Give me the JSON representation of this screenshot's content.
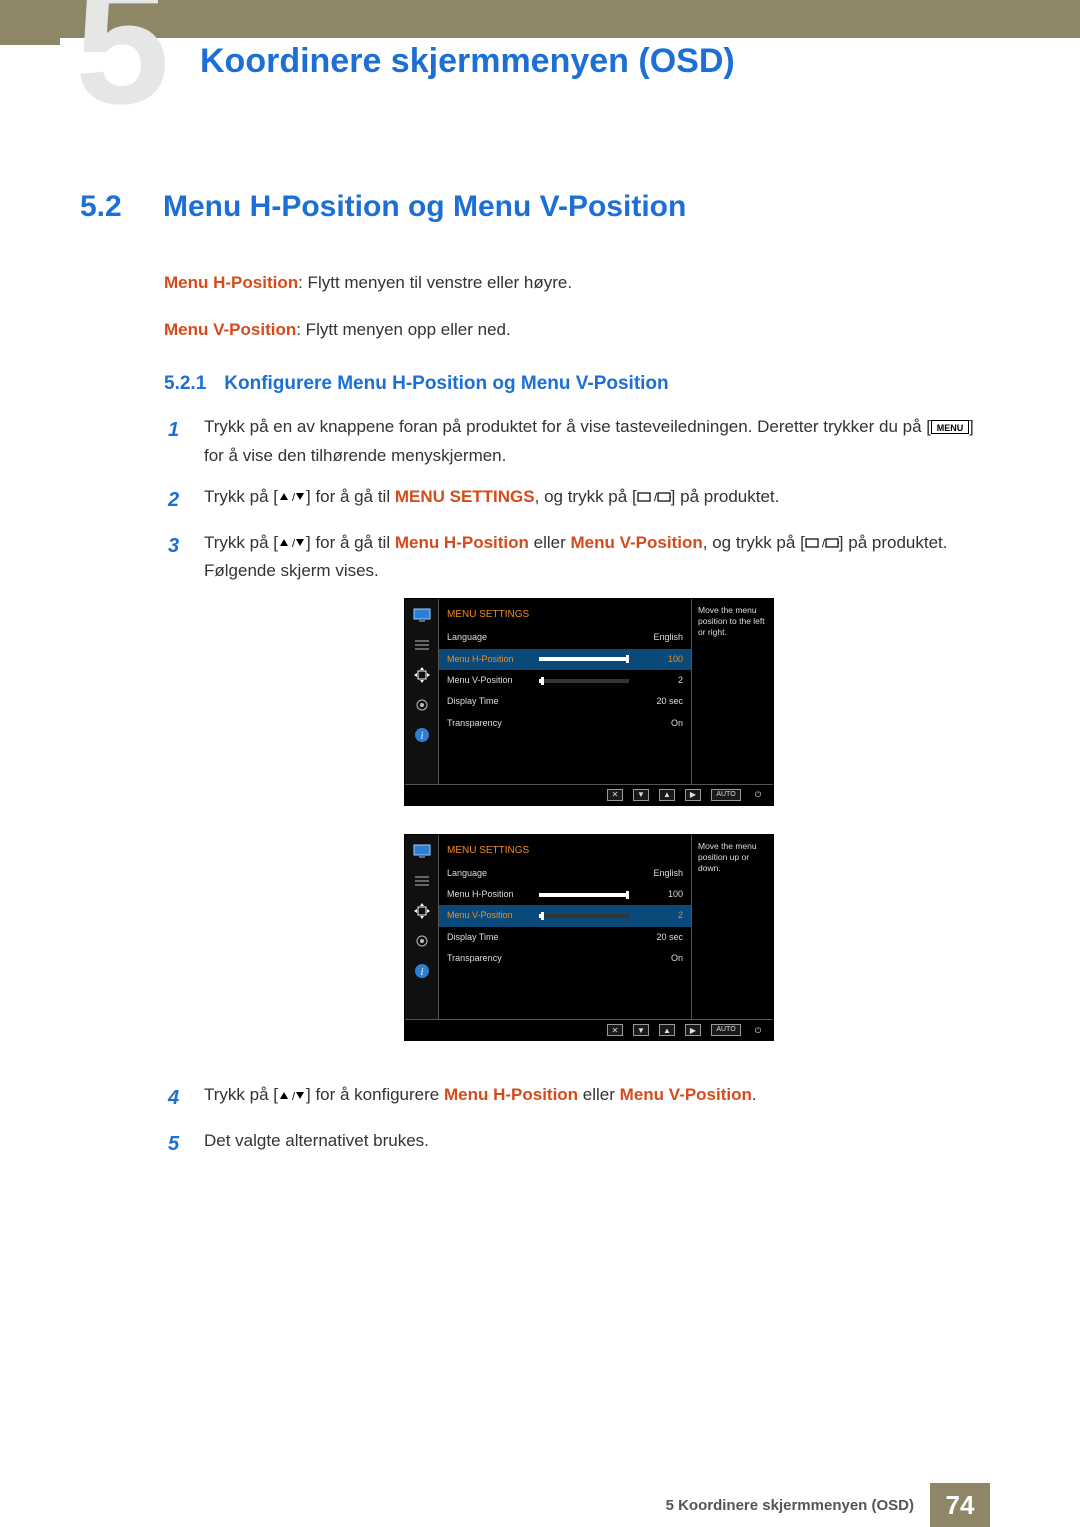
{
  "chapter": {
    "num": "5",
    "title": "Koordinere skjermmenyen (OSD)"
  },
  "section": {
    "num": "5.2",
    "title": "Menu H-Position og Menu V-Position"
  },
  "intro": {
    "h_label": "Menu H-Position",
    "h_text": ": Flytt menyen til venstre eller høyre.",
    "v_label": "Menu V-Position",
    "v_text": ": Flytt menyen opp eller ned."
  },
  "subsection": {
    "num": "5.2.1",
    "title": "Konfigurere Menu H-Position og Menu V-Position"
  },
  "steps": {
    "s1a": "Trykk på en av knappene foran på produktet for å vise tasteveiledningen. Deretter trykker du på [",
    "s1b": "] for å vise den tilhørende menyskjermen.",
    "menu_btn": "MENU",
    "s2a": "Trykk på [",
    "s2b": "] for å gå til ",
    "s2c": "MENU SETTINGS",
    "s2d": ", og trykk på [",
    "s2e": "] på produktet.",
    "s3a": "Trykk på [",
    "s3b": "] for å gå til ",
    "s3c": "Menu H-Position",
    "s3d": " eller ",
    "s3e": "Menu V-Position",
    "s3f": ", og trykk på [",
    "s3g": "] på produktet. Følgende skjerm vises.",
    "s4a": "Trykk på [",
    "s4b": "] for å konfigurere ",
    "s4c": "Menu H-Position",
    "s4d": " eller ",
    "s4e": "Menu V-Position",
    "s4f": ".",
    "s5": "Det valgte alternativet brukes."
  },
  "osd1": {
    "title": "MENU SETTINGS",
    "tip": "Move the menu position to the left or right.",
    "rows": {
      "r1": {
        "label": "Language",
        "val": "English"
      },
      "r2": {
        "label": "Menu H-Position",
        "val": "100",
        "fill": 100
      },
      "r3": {
        "label": "Menu V-Position",
        "val": "2",
        "fill": 2
      },
      "r4": {
        "label": "Display Time",
        "val": "20 sec"
      },
      "r5": {
        "label": "Transparency",
        "val": "On"
      }
    },
    "auto": "AUTO"
  },
  "osd2": {
    "title": "MENU SETTINGS",
    "tip": "Move the menu position up or down.",
    "rows": {
      "r1": {
        "label": "Language",
        "val": "English"
      },
      "r2": {
        "label": "Menu H-Position",
        "val": "100",
        "fill": 100
      },
      "r3": {
        "label": "Menu V-Position",
        "val": "2",
        "fill": 2
      },
      "r4": {
        "label": "Display Time",
        "val": "20 sec"
      },
      "r5": {
        "label": "Transparency",
        "val": "On"
      }
    },
    "auto": "AUTO"
  },
  "footer": {
    "text": "5 Koordinere skjermmenyen (OSD)",
    "page": "74"
  }
}
